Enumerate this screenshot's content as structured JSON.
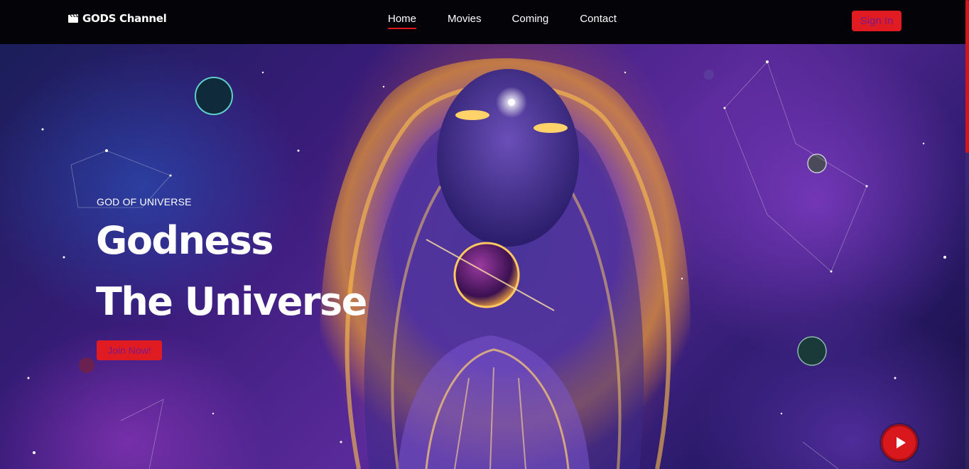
{
  "brand": {
    "name": "GODS Channel",
    "icon": "clapperboard-icon"
  },
  "nav": {
    "links": [
      {
        "label": "Home",
        "active": true
      },
      {
        "label": "Movies",
        "active": false
      },
      {
        "label": "Coming",
        "active": false
      },
      {
        "label": "Contact",
        "active": false
      }
    ],
    "signin_label": "Sign In"
  },
  "hero": {
    "eyebrow": "GOD OF UNIVERSE",
    "title_line1": "Godness",
    "title_line2": "The Universe",
    "cta_label": "Join Now!",
    "play_icon": "play-icon"
  },
  "colors": {
    "accent": "#e11b22",
    "button_text": "#7a1a8a",
    "nav_bg": "#040408"
  }
}
